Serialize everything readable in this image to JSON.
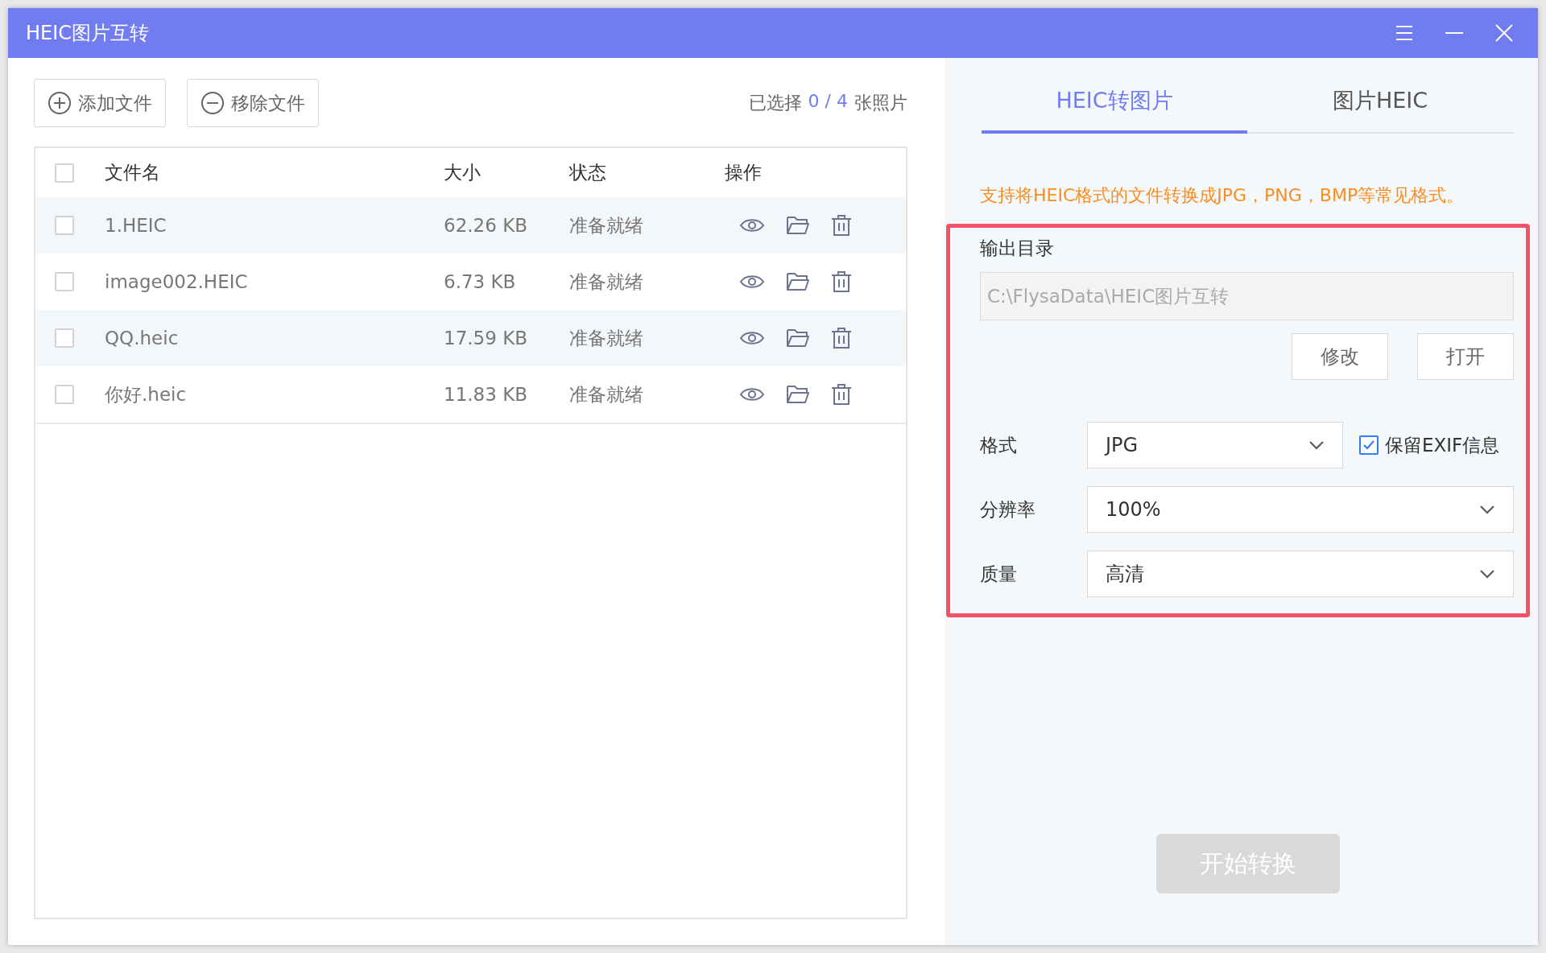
{
  "window": {
    "title": "HEIC图片互转"
  },
  "toolbar": {
    "buttons": [
      {
        "label": "添加文件",
        "kind": "add"
      },
      {
        "label": "移除文件",
        "kind": "remove"
      }
    ],
    "selection": {
      "prefix": "已选择",
      "count": "0 / 4",
      "suffix": "张照片"
    }
  },
  "table": {
    "all_checked": false,
    "columns": [
      "文件名",
      "大小",
      "状态",
      "操作"
    ],
    "rows": [
      {
        "name": "1.HEIC",
        "size": "62.26 KB",
        "status": "准备就绪",
        "checked": false
      },
      {
        "name": "image002.HEIC",
        "size": "6.73 KB",
        "status": "准备就绪",
        "checked": false
      },
      {
        "name": "QQ.heic",
        "size": "17.59 KB",
        "status": "准备就绪",
        "checked": false
      },
      {
        "name": "你好.heic",
        "size": "11.83 KB",
        "status": "准备就绪",
        "checked": false
      }
    ]
  },
  "tabs": [
    {
      "label": "HEIC转图片",
      "selected": true
    },
    {
      "label": "图片HEIC",
      "selected": false
    }
  ],
  "note": "支持将HEIC格式的文件转换成JPG，PNG，BMP等常见格式。",
  "output": {
    "label": "输出目录",
    "path": "C:\\FlysaData\\HEIC图片互转",
    "buttons": [
      "修改",
      "打开"
    ]
  },
  "format": {
    "label": "格式",
    "value": "JPG",
    "exif": {
      "label": "保留EXIF信息",
      "checked": true
    }
  },
  "resolution": {
    "label": "分辨率",
    "value": "100%"
  },
  "quality": {
    "label": "质量",
    "value": "高清"
  },
  "start_button": {
    "label": "开始转换",
    "disabled": true
  }
}
